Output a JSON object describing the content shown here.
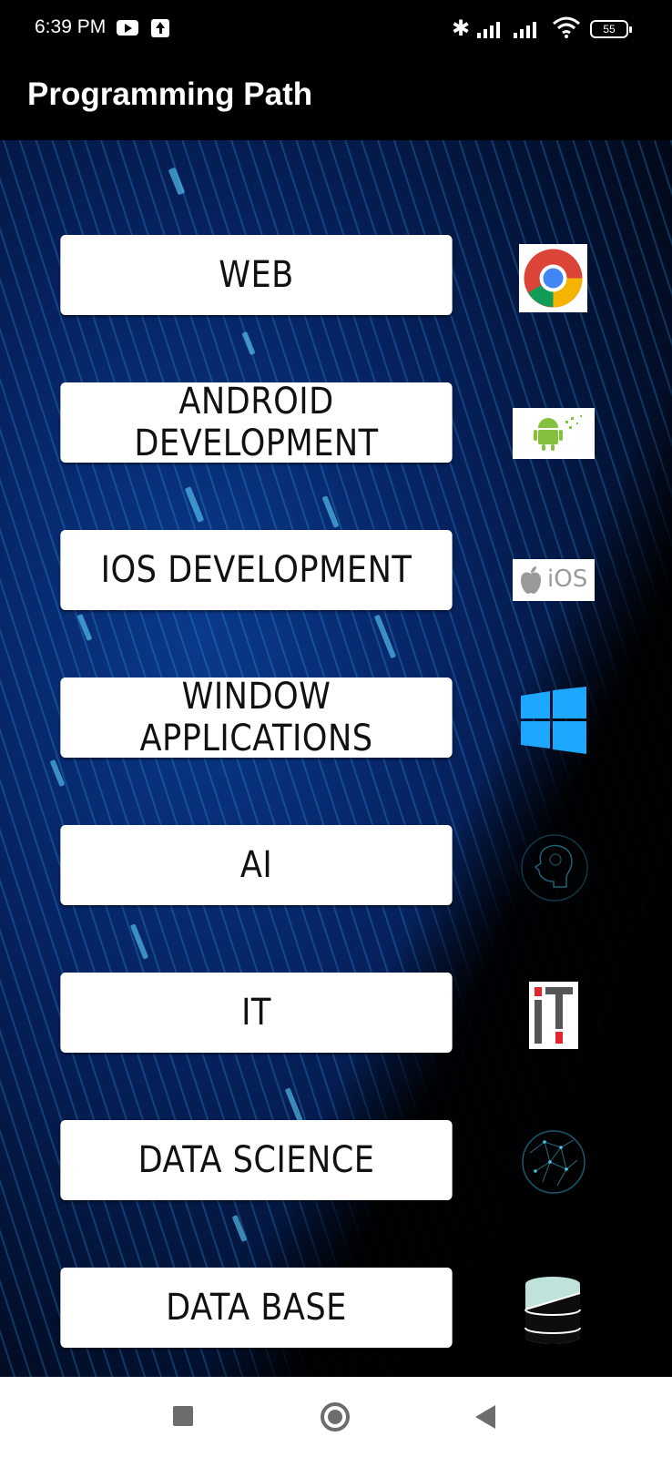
{
  "status_bar": {
    "time": "6:39 PM",
    "battery_level": "55",
    "icons": [
      "youtube-icon",
      "upload-icon",
      "bluetooth-icon",
      "signal-icon",
      "signal-icon",
      "wifi-icon",
      "battery-icon"
    ]
  },
  "app_bar": {
    "title": "Programming Path"
  },
  "paths": [
    {
      "label": "WEB",
      "icon": "chrome-icon"
    },
    {
      "label": "ANDROID DEVELOPMENT",
      "icon": "android-icon"
    },
    {
      "label": "IOS DEVELOPMENT",
      "icon": "apple-ios-icon",
      "icon_text": "iOS"
    },
    {
      "label": "WINDOW APPLICATIONS",
      "icon": "windows-icon"
    },
    {
      "label": "AI",
      "icon": "ai-brain-icon"
    },
    {
      "label": "IT",
      "icon": "it-logo-icon"
    },
    {
      "label": "DATA SCIENCE",
      "icon": "data-science-globe-icon"
    },
    {
      "label": "DATA BASE",
      "icon": "database-icon"
    }
  ],
  "nav_bar": {
    "buttons": [
      "recents-button",
      "home-button",
      "back-button"
    ]
  },
  "colors": {
    "background": "#000000",
    "button": "#ffffff",
    "nav_bar": "#ffffff",
    "nav_icon": "#6d6d6d",
    "accent_blue": "#1ea7ff"
  }
}
